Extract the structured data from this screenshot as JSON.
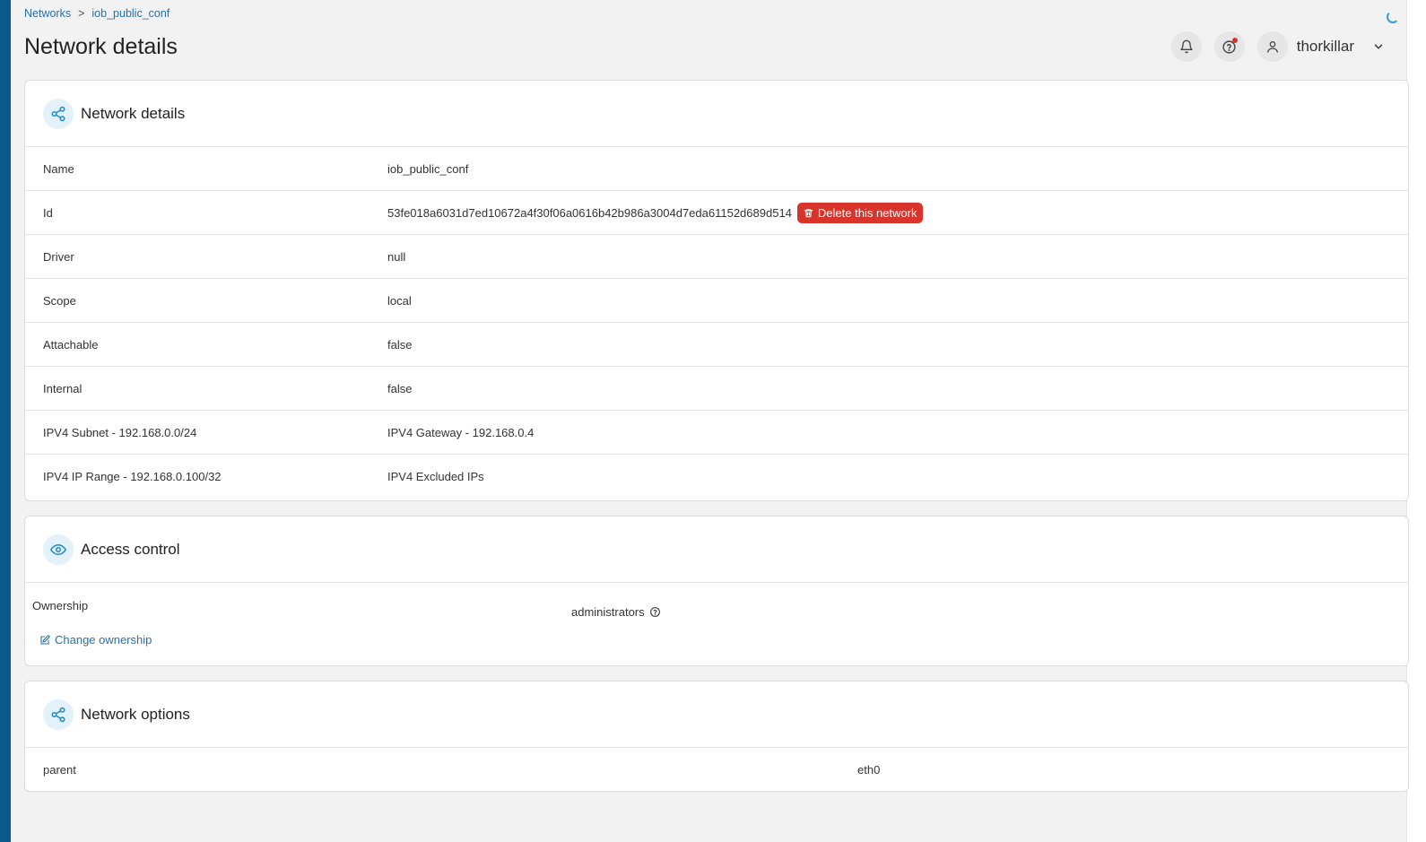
{
  "breadcrumb": {
    "parent": "Networks",
    "separator": ">",
    "current": "iob_public_conf"
  },
  "page": {
    "title": "Network details"
  },
  "header": {
    "username": "thorkillar"
  },
  "details_card": {
    "title": "Network details",
    "rows": [
      {
        "key": "Name",
        "value": "iob_public_conf"
      },
      {
        "key": "Id",
        "value": "53fe018a6031d7ed10672a4f30f06a0616b42b986a3004d7eda61152d689d514"
      },
      {
        "key": "Driver",
        "value": "null"
      },
      {
        "key": "Scope",
        "value": "local"
      },
      {
        "key": "Attachable",
        "value": "false"
      },
      {
        "key": "Internal",
        "value": "false"
      },
      {
        "key": "IPV4 Subnet - 192.168.0.0/24",
        "value": "IPV4 Gateway - 192.168.0.4"
      },
      {
        "key": "IPV4 IP Range - 192.168.0.100/32",
        "value": "IPV4 Excluded IPs"
      }
    ],
    "delete_label": "Delete this network"
  },
  "access_card": {
    "title": "Access control",
    "ownership_key": "Ownership",
    "ownership_value": "administrators",
    "change_label": "Change ownership"
  },
  "options_card": {
    "title": "Network options",
    "rows": [
      {
        "key": "parent",
        "value": "eth0"
      }
    ]
  },
  "colors": {
    "accent": "#2a6fa8",
    "danger": "#d9342b",
    "sidebar": "#0b5a8c"
  }
}
